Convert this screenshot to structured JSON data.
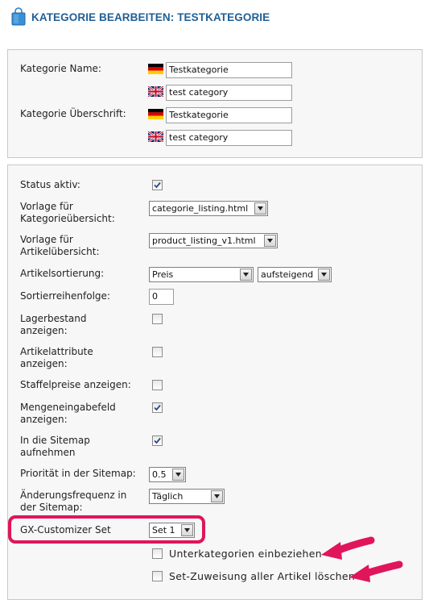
{
  "header": {
    "title": "KATEGORIE BEARBEITEN: TESTKATEGORIE",
    "icon": "shopping-bag-icon"
  },
  "names": {
    "label_name": "Kategorie Name:",
    "label_heading": "Kategorie Überschrift:",
    "name_de": "Testkategorie",
    "name_en": "test category",
    "heading_de": "Testkategorie",
    "heading_en": "test category"
  },
  "settings": {
    "status_label": "Status aktiv:",
    "status_checked": true,
    "template_overview_label": "Vorlage für Kategorieübersicht:",
    "template_overview_value": "categorie_listing.html",
    "template_article_label": "Vorlage für Artikelübersicht:",
    "template_article_value": "product_listing_v1.html",
    "sort_label": "Artikelsortierung:",
    "sort_field_value": "Preis",
    "sort_direction_value": "aufsteigend",
    "order_label": "Sortierreihenfolge:",
    "order_value": "0",
    "stock_label": "Lagerbestand anzeigen:",
    "stock_checked": false,
    "attributes_label": "Artikelattribute anzeigen:",
    "attributes_checked": false,
    "tiered_label": "Staffelpreise anzeigen:",
    "tiered_checked": false,
    "quantity_label": "Mengeneingabefeld anzeigen:",
    "quantity_checked": true,
    "sitemap_label": "In die Sitemap aufnehmen",
    "sitemap_checked": true,
    "priority_label": "Priorität in der Sitemap:",
    "priority_value": "0.5",
    "frequency_label": "Änderungsfrequenz in der Sitemap:",
    "frequency_value": "Täglich",
    "customizer_label": "GX-Customizer Set",
    "customizer_value": "Set 1",
    "include_subcategories_label": "Unterkategorien einbeziehen",
    "include_subcategories_checked": false,
    "delete_assignment_label": "Set-Zuweisung aller Artikel löschen",
    "delete_assignment_checked": false
  },
  "colors": {
    "title": "#1f5f96",
    "highlight": "#e0155c",
    "arrow": "#e0155c",
    "panel": "#f7f7f7"
  }
}
